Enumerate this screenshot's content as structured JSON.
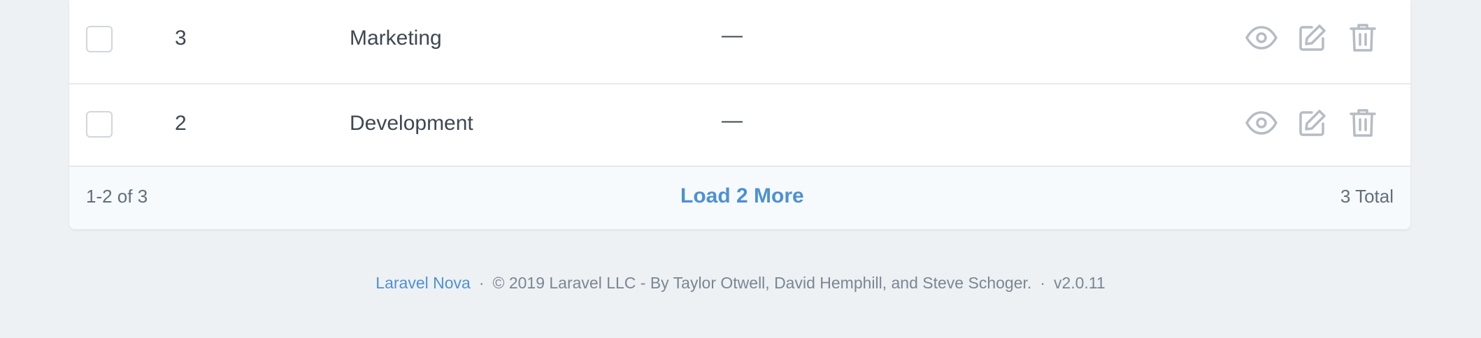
{
  "table": {
    "rows": [
      {
        "id": "3",
        "name": "Marketing",
        "description": "—"
      },
      {
        "id": "2",
        "name": "Development",
        "description": "—"
      }
    ],
    "actions": {
      "view_icon": "eye-icon",
      "edit_icon": "edit-icon",
      "delete_icon": "trash-icon"
    },
    "pagination": {
      "range": "1-2 of 3",
      "load_more": "Load 2 More",
      "total": "3 Total"
    }
  },
  "footer": {
    "brand_link": "Laravel Nova",
    "separator": "·",
    "copyright": "© 2019 Laravel LLC - By Taylor Otwell, David Hemphill, and Steve Schoger.",
    "version": "v2.0.11"
  },
  "colors": {
    "accent": "#4e91d2",
    "background": "#eef1f4",
    "icon": "#b5bcc3",
    "text": "#3d4852",
    "muted": "#606f7b"
  }
}
